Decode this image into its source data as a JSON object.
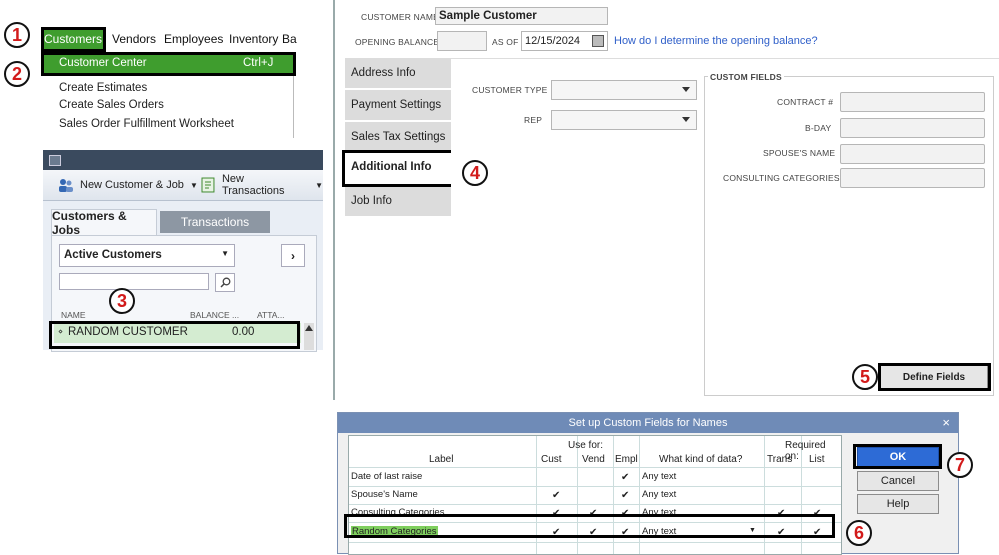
{
  "menu": {
    "items": [
      "Customers",
      "Vendors",
      "Employees",
      "Inventory",
      "Ba"
    ],
    "dropdown": {
      "customer_center": "Customer Center",
      "shortcut": "Ctrl+J",
      "create_estimates": "Create Estimates",
      "create_sales_orders": "Create Sales Orders",
      "sales_order_worksheet": "Sales Order Fulfillment Worksheet"
    }
  },
  "customer_center": {
    "new_customer_job": "New Customer & Job",
    "new_transactions": "New Transactions",
    "tab_customers_jobs": "Customers & Jobs",
    "tab_transactions": "Transactions",
    "filter": "Active Customers",
    "search_placeholder": "",
    "columns": [
      "NAME",
      "BALANCE ...",
      "ATTA..."
    ],
    "row": {
      "name": "RANDOM CUSTOMER",
      "balance": "0.00"
    }
  },
  "form": {
    "customer_name_label": "CUSTOMER NAME",
    "customer_name_value": "Sample Customer",
    "opening_balance_label": "OPENING BALANCE",
    "as_of_label": "AS OF",
    "as_of_value": "12/15/2024",
    "help_link": "How do I determine the opening balance?",
    "side_tabs": [
      "Address Info",
      "Payment Settings",
      "Sales Tax Settings",
      "Additional Info",
      "Job Info"
    ],
    "customer_type_label": "CUSTOMER TYPE",
    "rep_label": "REP",
    "custom_fields_title": "CUSTOM FIELDS",
    "custom_fields": [
      "CONTRACT #",
      "B-DAY",
      "SPOUSE'S NAME",
      "CONSULTING CATEGORIES"
    ],
    "define_fields": "Define Fields"
  },
  "dialog": {
    "title": "Set up Custom Fields for Names",
    "close": "×",
    "use_for": "Use for:",
    "required_on": "Required on:",
    "headers": {
      "label": "Label",
      "cust": "Cust",
      "vend": "Vend",
      "empl": "Empl",
      "kind": "What kind of data?",
      "trans": "Trans",
      "list": "List"
    },
    "rows": [
      {
        "label": "Date of last raise",
        "cust": "",
        "vend": "",
        "empl": "✔",
        "kind": "Any text",
        "trans": "",
        "list": ""
      },
      {
        "label": "Spouse's Name",
        "cust": "✔",
        "vend": "",
        "empl": "✔",
        "kind": "Any text",
        "trans": "",
        "list": ""
      },
      {
        "label": "Consulting Categories",
        "cust": "✔",
        "vend": "✔",
        "empl": "✔",
        "kind": "Any text",
        "trans": "✔",
        "list": "✔"
      },
      {
        "label": "Random Categories",
        "cust": "✔",
        "vend": "✔",
        "empl": "✔",
        "kind": "Any text",
        "trans": "✔",
        "list": "✔"
      }
    ],
    "ok": "OK",
    "cancel": "Cancel",
    "help": "Help"
  },
  "callouts": [
    "1",
    "2",
    "3",
    "4",
    "5",
    "6",
    "7"
  ],
  "colors": {
    "menu_highlight": "#3f9d2e",
    "row_highlight": "#d4ecd1",
    "dialog_title": "#6f8bb7",
    "ok_button": "#2d6bd6",
    "callout": "#d21a1a"
  }
}
